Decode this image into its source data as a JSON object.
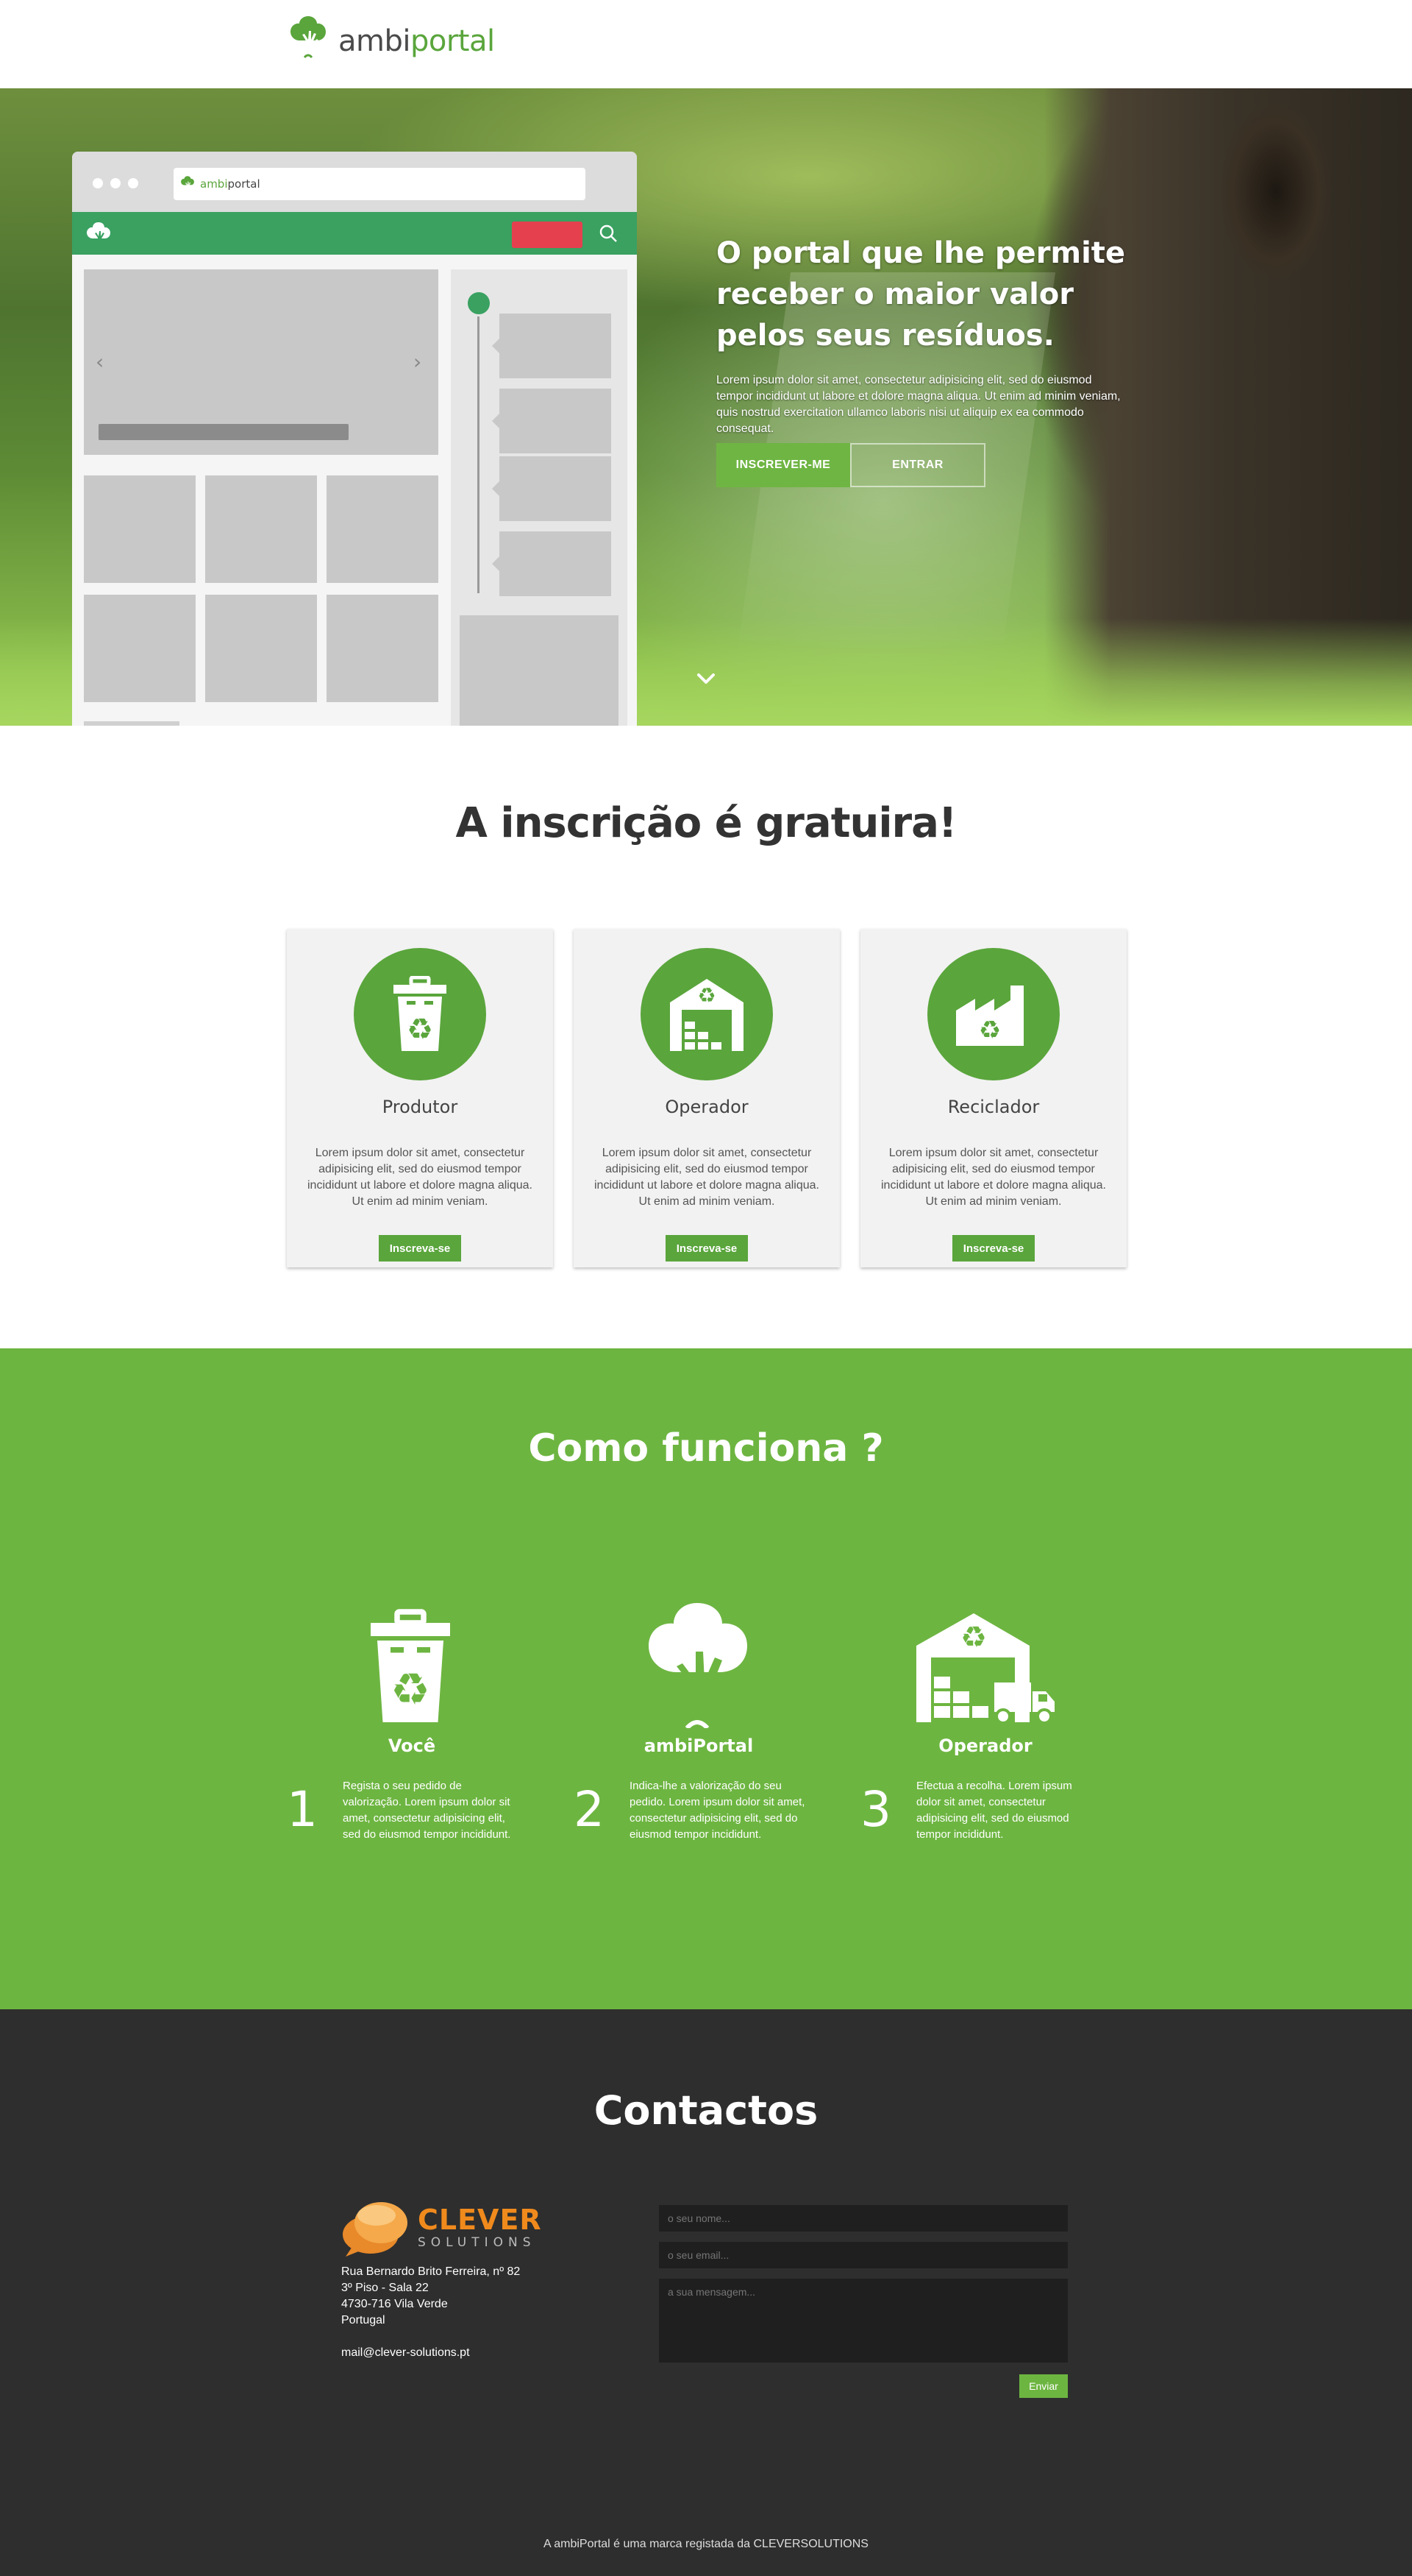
{
  "header": {
    "logo_prefix": "ambi",
    "logo_suffix": "portal"
  },
  "hero": {
    "mock_logo_prefix": "ambi",
    "mock_logo_suffix": "portal",
    "title": "O portal que lhe permite receber o maior valor pelos seus resíduos.",
    "description": "Lorem ipsum dolor sit amet, consectetur adipisicing elit, sed do eiusmod tempor incididunt ut labore et dolore magna aliqua. Ut enim ad minim veniam, quis nostrud exercitation ullamco laboris nisi ut aliquip ex ea commodo consequat.",
    "signup_label": "INSCREVER-ME",
    "login_label": "ENTRAR"
  },
  "signup": {
    "title": "A inscrição é gratuira!",
    "cards": [
      {
        "icon": "recycle-bin-icon",
        "title": "Produtor",
        "text": "Lorem ipsum dolor sit amet, consectetur adipisicing elit, sed do eiusmod tempor incididunt ut labore et dolore magna aliqua. Ut enim ad minim veniam.",
        "button": "Inscreva-se"
      },
      {
        "icon": "warehouse-icon",
        "title": "Operador",
        "text": "Lorem ipsum dolor sit amet, consectetur adipisicing elit, sed do eiusmod tempor incididunt ut labore et dolore magna aliqua. Ut enim ad minim veniam.",
        "button": "Inscreva-se"
      },
      {
        "icon": "factory-icon",
        "title": "Reciclador",
        "text": "Lorem ipsum dolor sit amet, consectetur adipisicing elit, sed do eiusmod tempor incididunt ut labore et dolore magna aliqua. Ut enim ad minim veniam.",
        "button": "Inscreva-se"
      }
    ]
  },
  "how": {
    "title": "Como funciona ?",
    "steps": [
      {
        "num": "1",
        "icon": "recycle-bin-icon",
        "label": "Você",
        "text": "Regista o seu pedido de valorização. Lorem ipsum dolor sit amet, consectetur adipisicing elit, sed do eiusmod tempor incididunt."
      },
      {
        "num": "2",
        "icon": "tree-hand-icon",
        "label": "ambiPortal",
        "text": "Indica-lhe a valorização do seu pedido. Lorem ipsum dolor sit amet, consectetur adipisicing elit, sed do eiusmod tempor incididunt."
      },
      {
        "num": "3",
        "icon": "warehouse-truck-icon",
        "label": "Operador",
        "text": "Efectua a recolha. Lorem ipsum dolor sit amet, consectetur adipisicing elit, sed do eiusmod tempor incididunt."
      }
    ]
  },
  "contacts": {
    "title": "Contactos",
    "company_word": "CLEVER",
    "company_sub": "SOLUTIONS",
    "address_lines": [
      "Rua Bernardo Brito Ferreira, nº 82",
      "3º Piso - Sala 22",
      "4730-716 Vila Verde",
      "Portugal"
    ],
    "email": "mail@clever-solutions.pt",
    "form": {
      "name_placeholder": "o seu nome...",
      "email_placeholder": "o seu email...",
      "message_placeholder": "a sua mensagem...",
      "send_label": "Enviar"
    }
  },
  "footer": {
    "note": "A ambiPortal é uma marca registada da CLEVERSOLUTIONS"
  },
  "colors": {
    "brand_green": "#5aa53c",
    "section_green": "#6db541",
    "mock_green": "#3aa161",
    "dark": "#2e2e2e",
    "clever_orange": "#f08a1c"
  }
}
